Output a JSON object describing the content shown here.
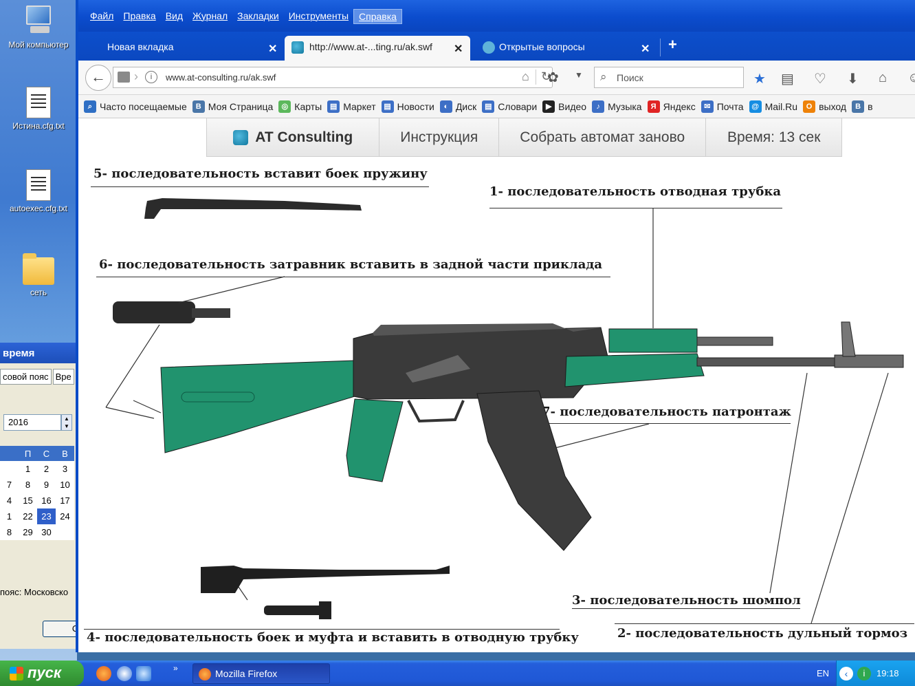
{
  "desktop": {
    "icons": [
      {
        "label": "Мой компьютер",
        "icon": "computer-icon"
      },
      {
        "label": "Истина.cfg.txt",
        "icon": "text-file-icon"
      },
      {
        "label": "autoexec.cfg.txt",
        "icon": "text-file-icon"
      },
      {
        "label": "сеть",
        "icon": "folder-icon"
      }
    ]
  },
  "datetime_panel": {
    "title": "время",
    "tabs": [
      "совой пояс",
      "Вре"
    ],
    "year": "2016",
    "weekdays": [
      "П",
      "С",
      "В"
    ],
    "weeks": [
      [
        "",
        "1",
        "2",
        "3"
      ],
      [
        "7",
        "8",
        "9",
        "10"
      ],
      [
        "4",
        "15",
        "16",
        "17"
      ],
      [
        "1",
        "22",
        "23",
        "24"
      ],
      [
        "8",
        "29",
        "30",
        ""
      ]
    ],
    "selected_day": "23",
    "timezone": "пояс: Московско",
    "ok_label": "О"
  },
  "browser": {
    "menu": [
      "Файл",
      "Правка",
      "Вид",
      "Журнал",
      "Закладки",
      "Инструменты",
      "Справка"
    ],
    "active_menu": "Справка",
    "tabs": [
      {
        "title": "Новая вкладка",
        "active": false
      },
      {
        "title": "http://www.at-...ting.ru/ak.swf",
        "active": true
      },
      {
        "title": "Открытые вопросы",
        "active": false
      }
    ],
    "url": "www.at-consulting.ru/ak.swf",
    "search_placeholder": "Поиск",
    "bookmarks": [
      {
        "label": "Часто посещаемые",
        "icon": "search-icon",
        "color": "#2f6fc4",
        "glyph": "⌕"
      },
      {
        "label": "Моя Страница",
        "icon": "vk-icon",
        "color": "#4a76a8",
        "glyph": "В"
      },
      {
        "label": "Карты",
        "icon": "maps-icon",
        "color": "#5cb85c",
        "glyph": "◎"
      },
      {
        "label": "Маркет",
        "icon": "market-icon",
        "color": "#3d6fc6",
        "glyph": "▤"
      },
      {
        "label": "Новости",
        "icon": "news-icon",
        "color": "#3d6fc6",
        "glyph": "▤"
      },
      {
        "label": "Диск",
        "icon": "disk-icon",
        "color": "#3d6fc6",
        "glyph": "◐"
      },
      {
        "label": "Словари",
        "icon": "dict-icon",
        "color": "#3d6fc6",
        "glyph": "▤"
      },
      {
        "label": "Видео",
        "icon": "video-icon",
        "color": "#222222",
        "glyph": "▶"
      },
      {
        "label": "Музыка",
        "icon": "music-icon",
        "color": "#3d6fc6",
        "glyph": "♪"
      },
      {
        "label": "Яндекс",
        "icon": "yandex-icon",
        "color": "#e02424",
        "glyph": "Я"
      },
      {
        "label": "Почта",
        "icon": "mail-icon",
        "color": "#3d6fc6",
        "glyph": "✉"
      },
      {
        "label": "Mail.Ru",
        "icon": "mailru-icon",
        "color": "#168de2",
        "glyph": "@"
      },
      {
        "label": "выход",
        "icon": "odnoklassniki-icon",
        "color": "#ee8208",
        "glyph": "О"
      },
      {
        "label": "в",
        "icon": "vk-icon",
        "color": "#4a76a8",
        "glyph": "В"
      }
    ]
  },
  "page": {
    "brand": "AT Consulting",
    "instructions_label": "Инструкция",
    "reassemble_label": "Собрать автомат заново",
    "timer_label": "Время: 13 сек",
    "labels": {
      "step1": "1- последовательность отводная трубка",
      "step2": "2- последовательность дульный тормоз",
      "step3": "3- последовательность шомпол",
      "step4": "4- последовательность боек и муфта и вставить в отводную трубку",
      "step5": "5- последовательность вставит боек пружину",
      "step6": "6- последовательность затравник вставить в задной части приклада",
      "step7": "7- последовательность патронтаж"
    },
    "colors": {
      "part_green": "#21936e",
      "metal": "#3c3c3c"
    }
  },
  "taskbar": {
    "start_label": "пуск",
    "task_label": "Mozilla Firefox",
    "lang": "EN",
    "time": "19:18"
  }
}
